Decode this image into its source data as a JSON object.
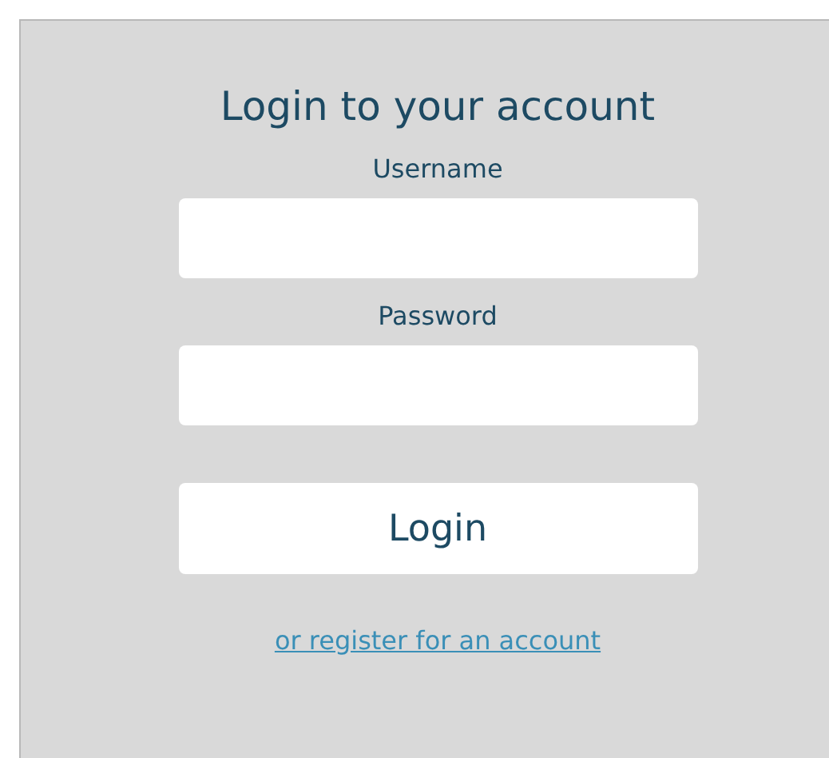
{
  "title": "Login to your account",
  "fields": [
    {
      "label": "Username"
    },
    {
      "label": "Password"
    }
  ],
  "login_button": "Login",
  "register_link": "or register for an account"
}
